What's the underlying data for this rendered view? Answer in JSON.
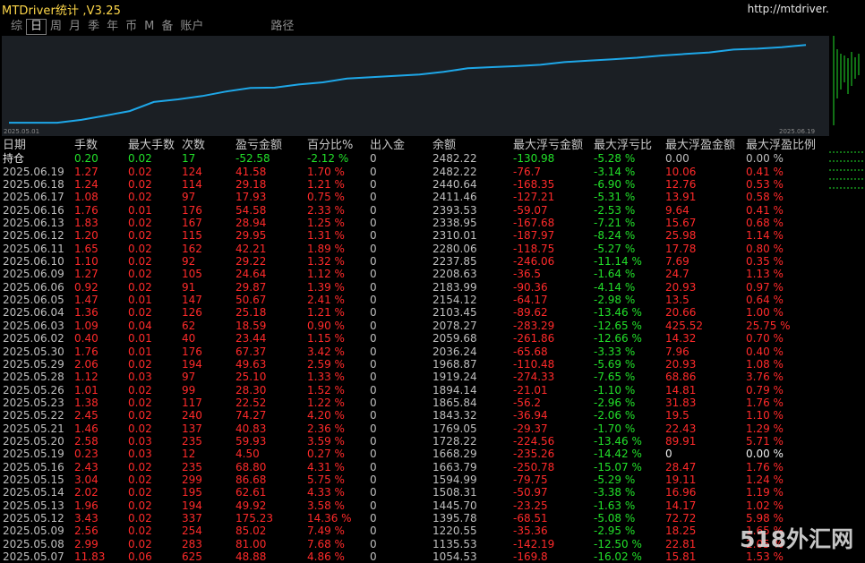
{
  "window": {
    "title": "MTDriver统计 ,V3.25",
    "url": "http://mtdriver.cn"
  },
  "tabs": [
    {
      "label": "综",
      "active": false
    },
    {
      "label": "日",
      "active": true
    },
    {
      "label": "周",
      "active": false
    },
    {
      "label": "月",
      "active": false
    },
    {
      "label": "季",
      "active": false
    },
    {
      "label": "年",
      "active": false
    },
    {
      "label": "币",
      "active": false
    },
    {
      "label": "M",
      "active": false
    },
    {
      "label": "备",
      "active": false
    },
    {
      "label": "账户",
      "active": false
    },
    {
      "label": "路径",
      "active": false
    }
  ],
  "equity_chart": {
    "start_label": "2025.05.01",
    "end_label": "2025.06.19",
    "line_color": "#1ea7e8",
    "background": "#1b1f24"
  },
  "columns": [
    "日期",
    "手数",
    "最大手数",
    "次数",
    "盈亏金额",
    "百分比%",
    "出入金",
    "余额",
    "最大浮亏金额",
    "最大浮亏比",
    "最大浮盈金额",
    "最大浮盈比例"
  ],
  "holding": {
    "label": "持仓",
    "lots": "0.20",
    "max_lots": "0.02",
    "count": "17",
    "pnl": "-52.58",
    "pct": "-2.12 %",
    "flow": "0",
    "balance": "2482.22",
    "max_float_loss": "-130.98",
    "max_float_loss_pct": "-5.28 %",
    "max_float_profit": "0.00",
    "max_float_profit_pct": "0.00 %"
  },
  "rows": [
    {
      "date": "2025.06.19",
      "lots": "1.27",
      "max_lots": "0.02",
      "count": "124",
      "pnl": "41.58",
      "pct": "1.70 %",
      "flow": "0",
      "balance": "2482.22",
      "mfl": "-76.7",
      "mflp": "-3.14 %",
      "mfp": "10.06",
      "mfpp": "0.41 %"
    },
    {
      "date": "2025.06.18",
      "lots": "1.24",
      "max_lots": "0.02",
      "count": "114",
      "pnl": "29.18",
      "pct": "1.21 %",
      "flow": "0",
      "balance": "2440.64",
      "mfl": "-168.35",
      "mflp": "-6.90 %",
      "mfp": "12.76",
      "mfpp": "0.53 %"
    },
    {
      "date": "2025.06.17",
      "lots": "1.08",
      "max_lots": "0.02",
      "count": "97",
      "pnl": "17.93",
      "pct": "0.75 %",
      "flow": "0",
      "balance": "2411.46",
      "mfl": "-127.21",
      "mflp": "-5.31 %",
      "mfp": "13.91",
      "mfpp": "0.58 %"
    },
    {
      "date": "2025.06.16",
      "lots": "1.76",
      "max_lots": "0.01",
      "count": "176",
      "pnl": "54.58",
      "pct": "2.33 %",
      "flow": "0",
      "balance": "2393.53",
      "mfl": "-59.07",
      "mflp": "-2.53 %",
      "mfp": "9.64",
      "mfpp": "0.41 %"
    },
    {
      "date": "2025.06.13",
      "lots": "1.83",
      "max_lots": "0.02",
      "count": "167",
      "pnl": "28.94",
      "pct": "1.25 %",
      "flow": "0",
      "balance": "2338.95",
      "mfl": "-167.68",
      "mflp": "-7.21 %",
      "mfp": "15.67",
      "mfpp": "0.68 %"
    },
    {
      "date": "2025.06.12",
      "lots": "1.20",
      "max_lots": "0.02",
      "count": "115",
      "pnl": "29.95",
      "pct": "1.31 %",
      "flow": "0",
      "balance": "2310.01",
      "mfl": "-187.97",
      "mflp": "-8.24 %",
      "mfp": "25.98",
      "mfpp": "1.14 %"
    },
    {
      "date": "2025.06.11",
      "lots": "1.65",
      "max_lots": "0.02",
      "count": "162",
      "pnl": "42.21",
      "pct": "1.89 %",
      "flow": "0",
      "balance": "2280.06",
      "mfl": "-118.75",
      "mflp": "-5.27 %",
      "mfp": "17.78",
      "mfpp": "0.80 %"
    },
    {
      "date": "2025.06.10",
      "lots": "1.10",
      "max_lots": "0.02",
      "count": "92",
      "pnl": "29.22",
      "pct": "1.32 %",
      "flow": "0",
      "balance": "2237.85",
      "mfl": "-246.06",
      "mflp": "-11.14 %",
      "mfp": "7.69",
      "mfpp": "0.35 %"
    },
    {
      "date": "2025.06.09",
      "lots": "1.27",
      "max_lots": "0.02",
      "count": "105",
      "pnl": "24.64",
      "pct": "1.12 %",
      "flow": "0",
      "balance": "2208.63",
      "mfl": "-36.5",
      "mflp": "-1.64 %",
      "mfp": "24.7",
      "mfpp": "1.13 %"
    },
    {
      "date": "2025.06.06",
      "lots": "0.92",
      "max_lots": "0.02",
      "count": "91",
      "pnl": "29.87",
      "pct": "1.39 %",
      "flow": "0",
      "balance": "2183.99",
      "mfl": "-90.36",
      "mflp": "-4.14 %",
      "mfp": "20.93",
      "mfpp": "0.97 %"
    },
    {
      "date": "2025.06.05",
      "lots": "1.47",
      "max_lots": "0.01",
      "count": "147",
      "pnl": "50.67",
      "pct": "2.41 %",
      "flow": "0",
      "balance": "2154.12",
      "mfl": "-64.17",
      "mflp": "-2.98 %",
      "mfp": "13.5",
      "mfpp": "0.64 %"
    },
    {
      "date": "2025.06.04",
      "lots": "1.36",
      "max_lots": "0.02",
      "count": "126",
      "pnl": "25.18",
      "pct": "1.21 %",
      "flow": "0",
      "balance": "2103.45",
      "mfl": "-89.62",
      "mflp": "-13.46 %",
      "mfp": "20.66",
      "mfpp": "1.00 %"
    },
    {
      "date": "2025.06.03",
      "lots": "1.09",
      "max_lots": "0.04",
      "count": "62",
      "pnl": "18.59",
      "pct": "0.90 %",
      "flow": "0",
      "balance": "2078.27",
      "mfl": "-283.29",
      "mflp": "-12.65 %",
      "mfp": "425.52",
      "mfpp": "25.75 %"
    },
    {
      "date": "2025.06.02",
      "lots": "0.40",
      "max_lots": "0.01",
      "count": "40",
      "pnl": "23.44",
      "pct": "1.15 %",
      "flow": "0",
      "balance": "2059.68",
      "mfl": "-261.86",
      "mflp": "-12.66 %",
      "mfp": "14.32",
      "mfpp": "0.70 %"
    },
    {
      "date": "2025.05.30",
      "lots": "1.76",
      "max_lots": "0.01",
      "count": "176",
      "pnl": "67.37",
      "pct": "3.42 %",
      "flow": "0",
      "balance": "2036.24",
      "mfl": "-65.68",
      "mflp": "-3.33 %",
      "mfp": "7.96",
      "mfpp": "0.40 %"
    },
    {
      "date": "2025.05.29",
      "lots": "2.06",
      "max_lots": "0.02",
      "count": "194",
      "pnl": "49.63",
      "pct": "2.59 %",
      "flow": "0",
      "balance": "1968.87",
      "mfl": "-110.48",
      "mflp": "-5.69 %",
      "mfp": "20.93",
      "mfpp": "1.08 %"
    },
    {
      "date": "2025.05.28",
      "lots": "1.12",
      "max_lots": "0.03",
      "count": "97",
      "pnl": "25.10",
      "pct": "1.33 %",
      "flow": "0",
      "balance": "1919.24",
      "mfl": "-274.33",
      "mflp": "-7.65 %",
      "mfp": "68.86",
      "mfpp": "3.76 %"
    },
    {
      "date": "2025.05.26",
      "lots": "1.01",
      "max_lots": "0.02",
      "count": "99",
      "pnl": "28.30",
      "pct": "1.52 %",
      "flow": "0",
      "balance": "1894.14",
      "mfl": "-21.01",
      "mflp": "-1.10 %",
      "mfp": "14.81",
      "mfpp": "0.79 %"
    },
    {
      "date": "2025.05.23",
      "lots": "1.38",
      "max_lots": "0.02",
      "count": "117",
      "pnl": "22.52",
      "pct": "1.22 %",
      "flow": "0",
      "balance": "1865.84",
      "mfl": "-56.2",
      "mflp": "-2.96 %",
      "mfp": "31.83",
      "mfpp": "1.76 %"
    },
    {
      "date": "2025.05.22",
      "lots": "2.45",
      "max_lots": "0.02",
      "count": "240",
      "pnl": "74.27",
      "pct": "4.20 %",
      "flow": "0",
      "balance": "1843.32",
      "mfl": "-36.94",
      "mflp": "-2.06 %",
      "mfp": "19.5",
      "mfpp": "1.10 %"
    },
    {
      "date": "2025.05.21",
      "lots": "1.46",
      "max_lots": "0.02",
      "count": "137",
      "pnl": "40.83",
      "pct": "2.36 %",
      "flow": "0",
      "balance": "1769.05",
      "mfl": "-29.37",
      "mflp": "-1.70 %",
      "mfp": "22.43",
      "mfpp": "1.29 %"
    },
    {
      "date": "2025.05.20",
      "lots": "2.58",
      "max_lots": "0.03",
      "count": "235",
      "pnl": "59.93",
      "pct": "3.59 %",
      "flow": "0",
      "balance": "1728.22",
      "mfl": "-224.56",
      "mflp": "-13.46 %",
      "mfp": "89.91",
      "mfpp": "5.71 %"
    },
    {
      "date": "2025.05.19",
      "lots": "0.23",
      "max_lots": "0.03",
      "count": "12",
      "pnl": "4.50",
      "pct": "0.27 %",
      "flow": "0",
      "balance": "1668.29",
      "mfl": "-235.26",
      "mflp": "-14.42 %",
      "mfp": "0",
      "mfpp": "0.00 %"
    },
    {
      "date": "2025.05.16",
      "lots": "2.43",
      "max_lots": "0.02",
      "count": "235",
      "pnl": "68.80",
      "pct": "4.31 %",
      "flow": "0",
      "balance": "1663.79",
      "mfl": "-250.78",
      "mflp": "-15.07 %",
      "mfp": "28.47",
      "mfpp": "1.76 %"
    },
    {
      "date": "2025.05.15",
      "lots": "3.04",
      "max_lots": "0.02",
      "count": "299",
      "pnl": "86.68",
      "pct": "5.75 %",
      "flow": "0",
      "balance": "1594.99",
      "mfl": "-79.75",
      "mflp": "-5.29 %",
      "mfp": "19.11",
      "mfpp": "1.24 %"
    },
    {
      "date": "2025.05.14",
      "lots": "2.02",
      "max_lots": "0.02",
      "count": "195",
      "pnl": "62.61",
      "pct": "4.33 %",
      "flow": "0",
      "balance": "1508.31",
      "mfl": "-50.97",
      "mflp": "-3.38 %",
      "mfp": "16.96",
      "mfpp": "1.19 %"
    },
    {
      "date": "2025.05.13",
      "lots": "1.96",
      "max_lots": "0.02",
      "count": "194",
      "pnl": "49.92",
      "pct": "3.58 %",
      "flow": "0",
      "balance": "1445.70",
      "mfl": "-23.25",
      "mflp": "-1.63 %",
      "mfp": "14.17",
      "mfpp": "1.02 %"
    },
    {
      "date": "2025.05.12",
      "lots": "3.43",
      "max_lots": "0.02",
      "count": "337",
      "pnl": "175.23",
      "pct": "14.36 %",
      "flow": "0",
      "balance": "1395.78",
      "mfl": "-68.51",
      "mflp": "-5.08 %",
      "mfp": "72.72",
      "mfpp": "5.98 %"
    },
    {
      "date": "2025.05.09",
      "lots": "2.56",
      "max_lots": "0.02",
      "count": "254",
      "pnl": "85.02",
      "pct": "7.49 %",
      "flow": "0",
      "balance": "1220.55",
      "mfl": "-35.36",
      "mflp": "-2.95 %",
      "mfp": "18.25",
      "mfpp": "1.65 %"
    },
    {
      "date": "2025.05.08",
      "lots": "2.99",
      "max_lots": "0.02",
      "count": "283",
      "pnl": "81.00",
      "pct": "7.68 %",
      "flow": "0",
      "balance": "1135.53",
      "mfl": "-142.19",
      "mflp": "-12.50 %",
      "mfp": "22.81",
      "mfpp": "2.05 %"
    },
    {
      "date": "2025.05.07",
      "lots": "11.83",
      "max_lots": "0.06",
      "count": "625",
      "pnl": "48.88",
      "pct": "4.86 %",
      "flow": "0",
      "balance": "1054.53",
      "mfl": "-169.8",
      "mflp": "-16.02 %",
      "mfp": "15.81",
      "mfpp": "1.53 %"
    }
  ],
  "watermark": "518外汇网"
}
